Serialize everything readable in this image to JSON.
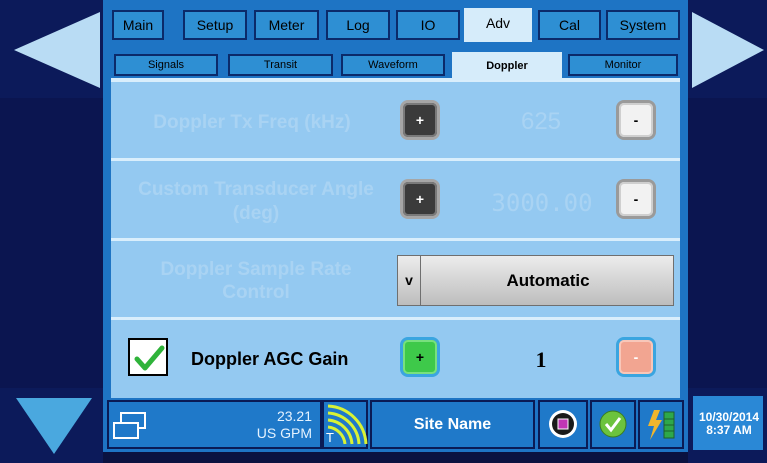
{
  "tabs": {
    "main": [
      "Main",
      "Setup",
      "Meter",
      "Log",
      "IO",
      "Adv",
      "Cal",
      "System"
    ],
    "active_main": "Adv",
    "sub": [
      "Signals",
      "Transit",
      "Waveform",
      "Doppler",
      "Monitor"
    ],
    "active_sub": "Doppler"
  },
  "rows": {
    "tx_freq": {
      "label": "Doppler Tx Freq (kHz)",
      "value": "625",
      "plus": "+",
      "minus": "-"
    },
    "angle": {
      "label_line1": "Custom Transducer Angle",
      "label_line2": "(deg)",
      "value": "3000.00",
      "plus": "+",
      "minus": "-"
    },
    "sample_rate": {
      "label_line1": "Doppler Sample Rate",
      "label_line2": "Control",
      "dropdown_arrow": "v",
      "selected": "Automatic"
    },
    "agc": {
      "label": "Doppler AGC Gain",
      "value": "1",
      "plus": "+",
      "minus": "-",
      "checked": true
    }
  },
  "status": {
    "flow_value": "23.21",
    "flow_unit": "US GPM",
    "signal_letter": "T",
    "site_name": "Site Name",
    "date": "10/30/2014",
    "time": "8:37 AM"
  },
  "colors": {
    "panel_bg": "#94c9f1",
    "tab_blue": "#2e8fd3",
    "active_tab": "#d6ecfa",
    "dark_bg": "#0a1240",
    "plus_green": "#3ec94a",
    "minus_salmon": "#f2a591"
  }
}
